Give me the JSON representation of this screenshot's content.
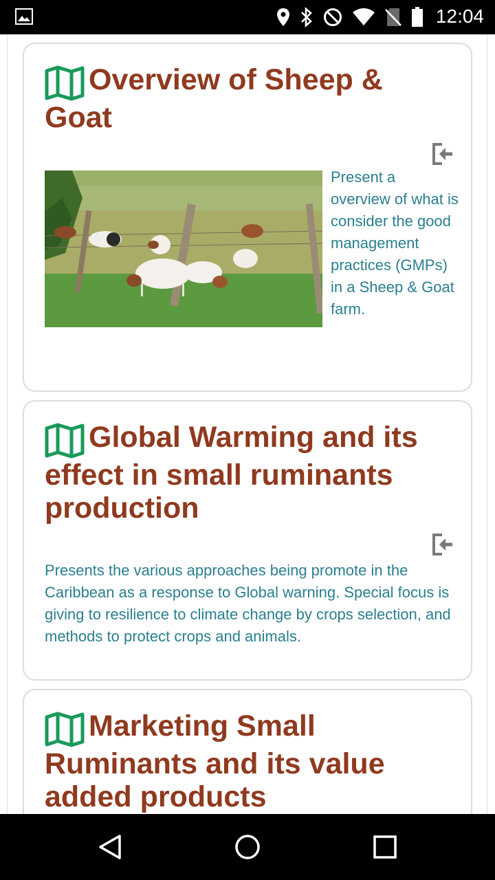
{
  "status_bar": {
    "time": "12:04",
    "icons": [
      "image-icon",
      "location-icon",
      "bluetooth-icon",
      "do-not-disturb-icon",
      "wifi-icon",
      "no-sim-icon",
      "battery-icon"
    ]
  },
  "cards": [
    {
      "title": "Overview of Sheep & Goat",
      "description": "Present a overview of what is consider the good management practices (GMPs) in a Sheep & Goat farm.",
      "has_image": true
    },
    {
      "title": "Global Warming and its effect in small ruminants production",
      "description": "Presents the various approaches being promote in the Caribbean as a response to Global warning. Special focus is giving to resilience to climate change  by crops selection, and methods to protect crops and animals."
    },
    {
      "title": "Marketing Small Ruminants and its value added products"
    }
  ],
  "nav_bar": {
    "buttons": [
      "back",
      "home",
      "recents"
    ]
  },
  "colors": {
    "title": "#8f3a1f",
    "description": "#2a7f8f",
    "map_icon": "#1a9a5a",
    "exit_icon": "#7a7a7a"
  }
}
